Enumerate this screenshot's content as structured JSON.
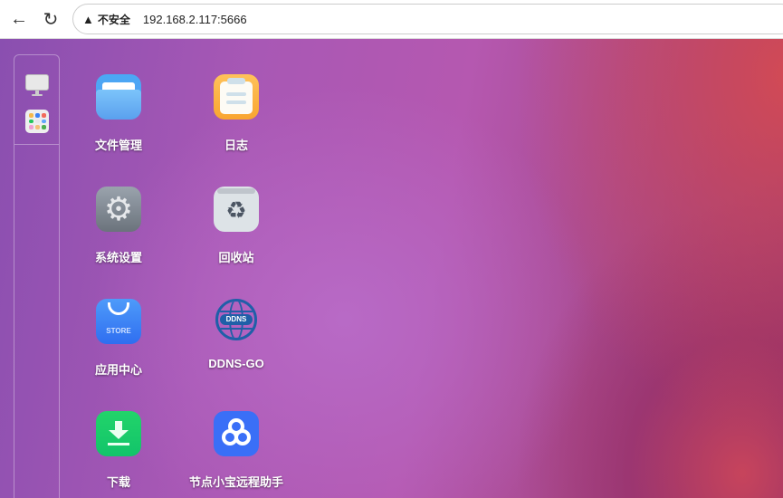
{
  "browser": {
    "back": "←",
    "reload": "↻",
    "security_label": "不安全",
    "url": "192.168.2.117:5666"
  },
  "sidebar": {
    "items": [
      {
        "name": "desktop"
      },
      {
        "name": "apps"
      }
    ]
  },
  "apps": [
    {
      "label": "文件管理",
      "icon": "folder-icon"
    },
    {
      "label": "日志",
      "icon": "log-icon"
    },
    {
      "label": "系统设置",
      "icon": "settings-icon"
    },
    {
      "label": "回收站",
      "icon": "recycle-bin-icon"
    },
    {
      "label": "应用中心",
      "icon": "store-icon",
      "icon_text": "STORE"
    },
    {
      "label": "DDNS-GO",
      "icon": "ddns-icon",
      "icon_text": "DDNS"
    },
    {
      "label": "下载",
      "icon": "download-icon"
    },
    {
      "label": "节点小宝远程助手",
      "icon": "remote-assistant-icon"
    }
  ]
}
